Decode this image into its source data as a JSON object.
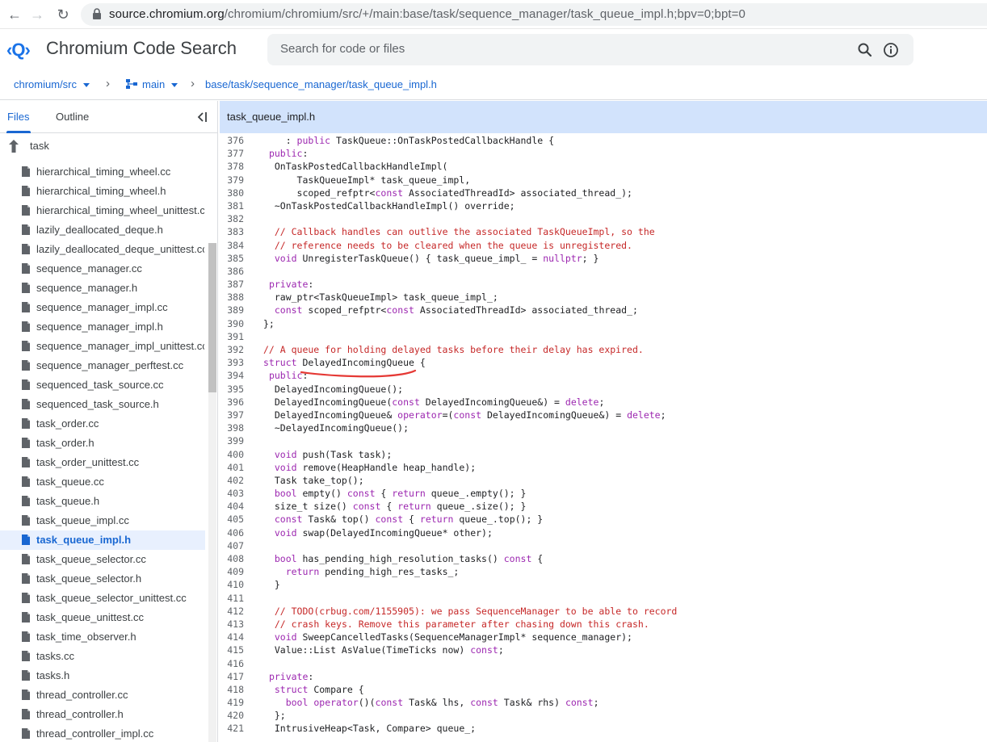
{
  "browser": {
    "url_host": "source.chromium.org",
    "url_path": "/chromium/chromium/src/+/main:base/task/sequence_manager/task_queue_impl.h;bpv=0;bpt=0"
  },
  "app": {
    "logo": "‹Q›",
    "title": "Chromium Code Search",
    "search_placeholder": "Search for code or files"
  },
  "breadcrumb": {
    "project": "chromium/src",
    "branch": "main",
    "path": "base/task/sequence_manager/task_queue_impl.h"
  },
  "sidebar": {
    "tabs": [
      "Files",
      "Outline"
    ],
    "active_tab": "Files",
    "parent_folder": "task",
    "files": [
      "hierarchical_timing_wheel.cc",
      "hierarchical_timing_wheel.h",
      "hierarchical_timing_wheel_unittest.cc",
      "lazily_deallocated_deque.h",
      "lazily_deallocated_deque_unittest.cc",
      "sequence_manager.cc",
      "sequence_manager.h",
      "sequence_manager_impl.cc",
      "sequence_manager_impl.h",
      "sequence_manager_impl_unittest.cc",
      "sequence_manager_perftest.cc",
      "sequenced_task_source.cc",
      "sequenced_task_source.h",
      "task_order.cc",
      "task_order.h",
      "task_order_unittest.cc",
      "task_queue.cc",
      "task_queue.h",
      "task_queue_impl.cc",
      "task_queue_impl.h",
      "task_queue_selector.cc",
      "task_queue_selector.h",
      "task_queue_selector_unittest.cc",
      "task_queue_unittest.cc",
      "task_time_observer.h",
      "tasks.cc",
      "tasks.h",
      "thread_controller.cc",
      "thread_controller.h",
      "thread_controller_impl.cc"
    ],
    "selected_file": "task_queue_impl.h"
  },
  "editor": {
    "file_title": "task_queue_impl.h",
    "first_line_number": 376,
    "lines": [
      "    : public TaskQueue::OnTaskPostedCallbackHandle {",
      " public:",
      "  OnTaskPostedCallbackHandleImpl(",
      "      TaskQueueImpl* task_queue_impl,",
      "      scoped_refptr<const AssociatedThreadId> associated_thread_);",
      "  ~OnTaskPostedCallbackHandleImpl() override;",
      "",
      "  // Callback handles can outlive the associated TaskQueueImpl, so the",
      "  // reference needs to be cleared when the queue is unregistered.",
      "  void UnregisterTaskQueue() { task_queue_impl_ = nullptr; }",
      "",
      " private:",
      "  raw_ptr<TaskQueueImpl> task_queue_impl_;",
      "  const scoped_refptr<const AssociatedThreadId> associated_thread_;",
      "};",
      "",
      "// A queue for holding delayed tasks before their delay has expired.",
      "struct DelayedIncomingQueue {",
      " public:",
      "  DelayedIncomingQueue();",
      "  DelayedIncomingQueue(const DelayedIncomingQueue&) = delete;",
      "  DelayedIncomingQueue& operator=(const DelayedIncomingQueue&) = delete;",
      "  ~DelayedIncomingQueue();",
      "",
      "  void push(Task task);",
      "  void remove(HeapHandle heap_handle);",
      "  Task take_top();",
      "  bool empty() const { return queue_.empty(); }",
      "  size_t size() const { return queue_.size(); }",
      "  const Task& top() const { return queue_.top(); }",
      "  void swap(DelayedIncomingQueue* other);",
      "",
      "  bool has_pending_high_resolution_tasks() const {",
      "    return pending_high_res_tasks_;",
      "  }",
      "",
      "  // TODO(crbug.com/1155905): we pass SequenceManager to be able to record",
      "  // crash keys. Remove this parameter after chasing down this crash.",
      "  void SweepCancelledTasks(SequenceManagerImpl* sequence_manager);",
      "  Value::List AsValue(TimeTicks now) const;",
      "",
      " private:",
      "  struct Compare {",
      "    bool operator()(const Task& lhs, const Task& rhs) const;",
      "  };",
      "  IntrusiveHeap<Task, Compare> queue_;"
    ]
  },
  "colors": {
    "accent": "#1967d2",
    "keyword": "#9c27b0",
    "comment": "#c62828",
    "header_bg": "#d2e3fc",
    "selected_bg": "#e8f0fe"
  }
}
